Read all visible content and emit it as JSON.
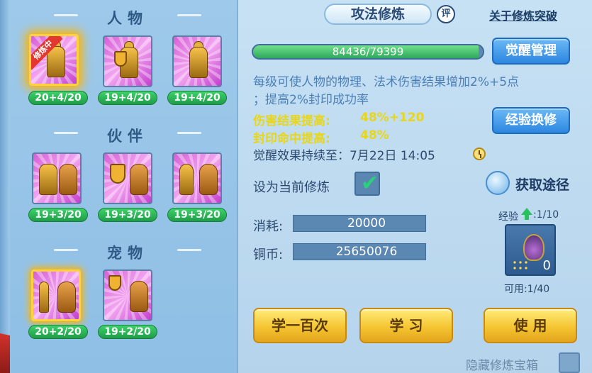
{
  "left": {
    "sections": [
      {
        "title": "人物"
      },
      {
        "title": "伙伴"
      },
      {
        "title": "宠物"
      }
    ],
    "training_badge": "修炼中",
    "character_levels": [
      "20+4/20",
      "19+4/20",
      "19+4/20"
    ],
    "partner_levels": [
      "19+3/20",
      "19+3/20",
      "19+3/20"
    ],
    "pet_levels": [
      "20+2/20",
      "19+2/20"
    ]
  },
  "header": {
    "title": "攻法修炼",
    "review_icon_label": "评",
    "about_link": "关于修炼突破"
  },
  "progress": {
    "text": "84436/79399",
    "fill_fraction": 0.98
  },
  "buttons": {
    "awaken_manage": "觉醒管理",
    "exp_exchange": "经验换修",
    "learn_100": "学一百次",
    "learn": "学 习",
    "use": "使 用"
  },
  "description": {
    "line1": "每级可使人物的物理、法术伤害结果增加2%+5点",
    "line2": "；提高2%封印成功率"
  },
  "stats": [
    {
      "label": "伤害结果提高:",
      "value": "48%+120"
    },
    {
      "label": "封印命中提高:",
      "value": "48%"
    }
  ],
  "expire": "觉醒效果持续至：7月22日 14:05",
  "set_current": {
    "label": "设为当前修炼",
    "checked": true
  },
  "obtain": {
    "label": "获取途径"
  },
  "costs": {
    "consume_label": "消耗:",
    "consume_value": "20000",
    "copper_label": "铜币:",
    "copper_value": "25650076"
  },
  "item": {
    "exp_label": "经验",
    "exp_ratio": ":1/10",
    "count": "0",
    "usable": "可用:1/40"
  },
  "footer": {
    "hide_label": "隐藏修炼宝箱"
  },
  "colors": {
    "accent_blue": "#2d87e0",
    "gold": "#f5c532",
    "stat_yellow": "#e8d61a",
    "level_green": "#1f9b48",
    "slot_purple": "#d65fd6"
  }
}
